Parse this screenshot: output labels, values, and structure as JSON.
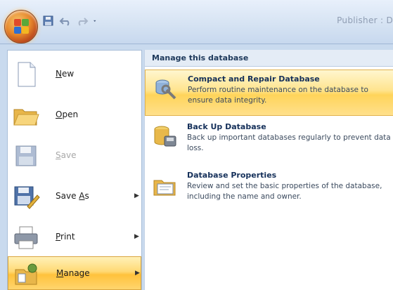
{
  "window": {
    "title": "Publisher : D"
  },
  "quick_access": {
    "icons": [
      "save-icon",
      "undo-icon",
      "redo-icon",
      "customize-qat-icon"
    ]
  },
  "file_menu": {
    "items": [
      {
        "label": "New",
        "mnemonic": "N",
        "icon": "new-document-icon",
        "submenu": false,
        "enabled": true
      },
      {
        "label": "Open",
        "mnemonic": "O",
        "icon": "open-folder-icon",
        "submenu": false,
        "enabled": true
      },
      {
        "label": "Save",
        "mnemonic": "S",
        "icon": "save-disk-icon",
        "submenu": false,
        "enabled": false
      },
      {
        "label": "Save As",
        "mnemonic": "A",
        "icon": "save-as-icon",
        "submenu": true,
        "enabled": true
      },
      {
        "label": "Print",
        "mnemonic": "P",
        "icon": "printer-icon",
        "submenu": true,
        "enabled": true
      },
      {
        "label": "Manage",
        "mnemonic": "M",
        "icon": "manage-icon",
        "submenu": true,
        "enabled": true,
        "selected": true
      }
    ]
  },
  "submenu": {
    "header": "Manage this database",
    "items": [
      {
        "title": "Compact and Repair Database",
        "description": "Perform routine maintenance on the database to ensure data integrity.",
        "icon": "compact-repair-icon",
        "highlighted": true
      },
      {
        "title": "Back Up Database",
        "description": "Back up important databases regularly to prevent data loss.",
        "icon": "backup-database-icon",
        "highlighted": false
      },
      {
        "title": "Database Properties",
        "description": "Review and set the basic properties of the database, including the name and owner.",
        "icon": "database-properties-icon",
        "highlighted": false
      }
    ]
  },
  "colors": {
    "highlight": "#ffd45a",
    "menu_bg": "#c9daee",
    "header_text": "#1e395b"
  }
}
